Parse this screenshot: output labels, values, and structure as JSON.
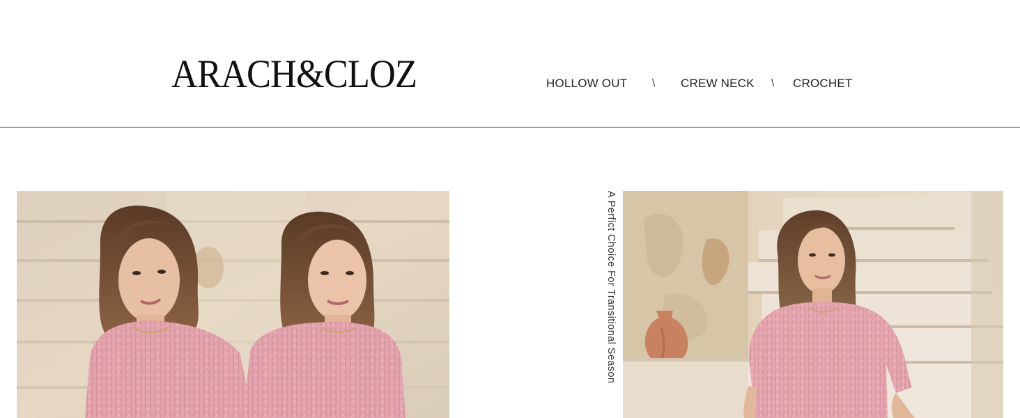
{
  "brand": {
    "logo_text": "ARACH&CLOZ"
  },
  "nav": {
    "items": [
      {
        "label": "HOLLOW OUT"
      },
      {
        "label": "CREW NECK"
      },
      {
        "label": "CROCHET"
      }
    ],
    "separator": "\\"
  },
  "tagline": "A Perfict Choice For Transitional Season",
  "colors": {
    "sweater_pink": "#e3a3ad",
    "background_stone": "#e4d5bd",
    "text": "#222222"
  }
}
